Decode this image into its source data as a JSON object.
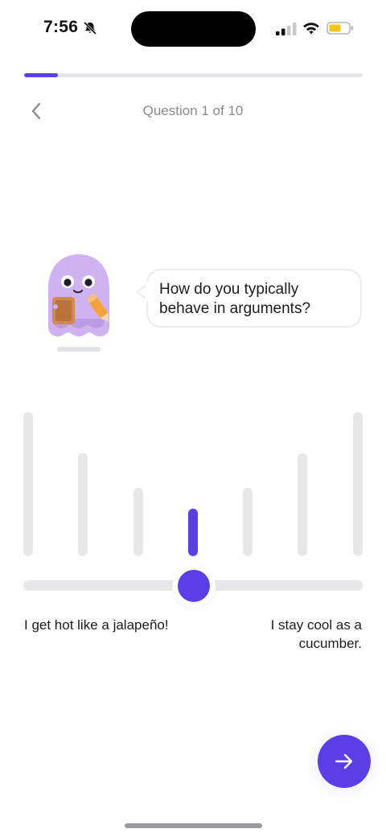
{
  "status_bar": {
    "time": "7:56",
    "icons": [
      "bell-muted-icon",
      "cellular-signal-icon",
      "wifi-icon",
      "battery-low-icon"
    ],
    "battery_color": "#f5c518"
  },
  "progress": {
    "current": 1,
    "total": 10,
    "fraction": 0.1
  },
  "header": {
    "back_icon": "chevron-left-icon",
    "counter": "Question 1 of 10"
  },
  "question": {
    "text": "How do you typically behave in arguments?",
    "mascot": "purple-ghost-notepad-icon"
  },
  "scale": {
    "options": 7,
    "selected_index": 3,
    "left_label": "I get hot like a jalapeño!",
    "right_label": "I stay cool as a cucumber."
  },
  "next_button": {
    "icon": "arrow-right-icon"
  },
  "colors": {
    "accent": "#5b3ee6",
    "inactive": "#e8e8eb",
    "text": "#1c1c1e",
    "muted": "#8a8a8e",
    "mascot": "#cfb3f0"
  }
}
